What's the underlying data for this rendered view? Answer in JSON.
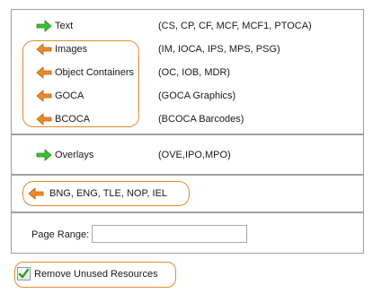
{
  "resources": [
    {
      "label": "Text",
      "desc": "(CS, CP, CF, MCF, MCF1, PTOCA)",
      "icon": "green-arrow-right-icon",
      "color": "#2eb82e"
    },
    {
      "label": "Images",
      "desc": "(IM, IOCA, IPS, MPS, PSG)",
      "icon": "orange-arrow-left-icon",
      "color": "#f28c28"
    },
    {
      "label": "Object Containers",
      "desc": "(OC, IOB, MDR)",
      "icon": "orange-arrow-left-icon",
      "color": "#f28c28"
    },
    {
      "label": "GOCA",
      "desc": "(GOCA Graphics)",
      "icon": "orange-arrow-left-icon",
      "color": "#f28c28"
    },
    {
      "label": "BCOCA",
      "desc": "(BCOCA Barcodes)",
      "icon": "orange-arrow-left-icon",
      "color": "#f28c28"
    }
  ],
  "overlays": {
    "label": "Overlays",
    "desc": "(OVE,IPO,MPO)",
    "icon": "green-arrow-right-icon"
  },
  "records": {
    "label": "BNG, ENG, TLE, NOP, IEL",
    "icon": "orange-arrow-left-icon"
  },
  "page_range": {
    "label": "Page Range:",
    "value": ""
  },
  "remove_unused": {
    "label": "Remove Unused Resources",
    "checked": true
  },
  "colors": {
    "green_arrow": "#3cbf2f",
    "orange_arrow": "#f08a24",
    "highlight": "#e58a2d"
  }
}
